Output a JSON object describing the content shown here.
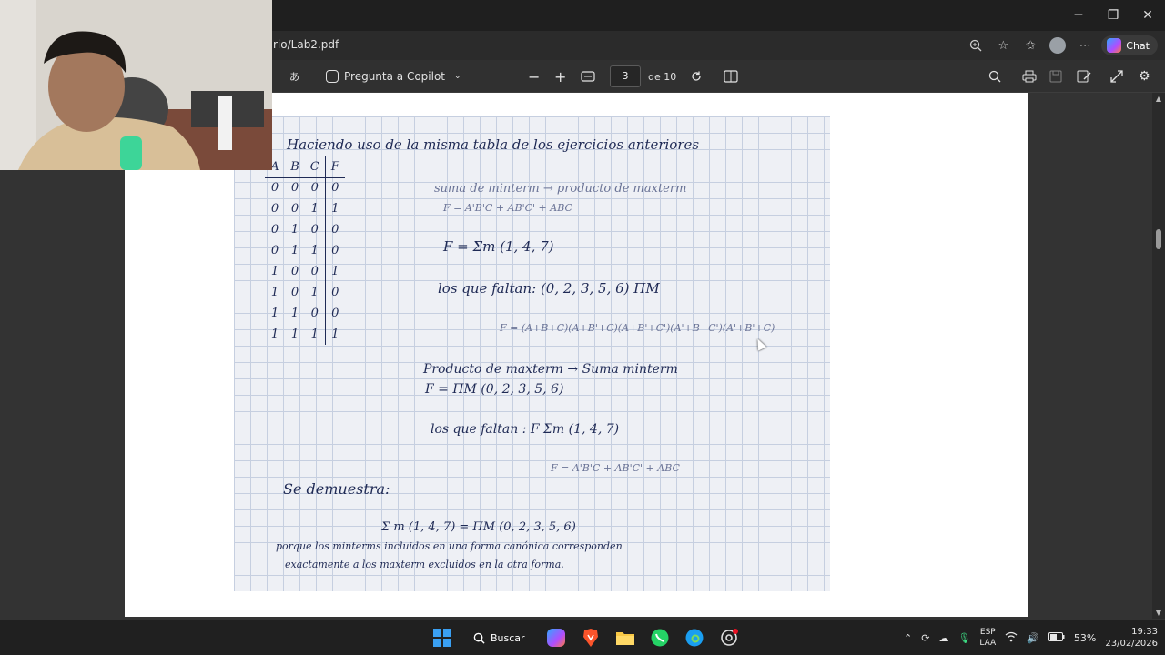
{
  "window": {
    "minimize": "─",
    "restore": "❐",
    "close": "✕"
  },
  "address": {
    "url": "rio/Lab2.pdf",
    "chat_label": "Chat",
    "more": "⋯"
  },
  "pdf_toolbar": {
    "copilot_label": "Pregunta a Copilot",
    "zoom_out": "−",
    "zoom_in": "+",
    "page_current": "3",
    "page_total": "de 10"
  },
  "notes": {
    "heading": "Haciendo uso de la misma tabla de los ejercicios anteriores",
    "table_header": [
      "A",
      "B",
      "C",
      "F"
    ],
    "table_rows": [
      [
        "0",
        "0",
        "0",
        "0"
      ],
      [
        "0",
        "0",
        "1",
        "1"
      ],
      [
        "0",
        "1",
        "0",
        "0"
      ],
      [
        "0",
        "1",
        "1",
        "0"
      ],
      [
        "1",
        "0",
        "0",
        "1"
      ],
      [
        "1",
        "0",
        "1",
        "0"
      ],
      [
        "1",
        "1",
        "0",
        "0"
      ],
      [
        "1",
        "1",
        "1",
        "1"
      ]
    ],
    "line1": "suma de minterm → producto de maxterm",
    "line2": "F = A'B'C + AB'C' + ABC",
    "line3": "F = Σm (1, 4, 7)",
    "line4": "los que faltan: (0, 2, 3, 5, 6) ΠM",
    "line5": "F = (A+B+C)(A+B'+C)(A+B'+C')(A'+B+C')(A'+B'+C)",
    "line6": "Producto de maxterm → Suma minterm",
    "line7": "F = ΠM (0, 2, 3, 5, 6)",
    "line8": "los que faltan : F Σm (1, 4, 7)",
    "line9": "F = A'B'C + AB'C' + ABC",
    "line10": "Se demuestra:",
    "line11": "Σ m (1, 4, 7) = ΠM (0, 2, 3, 5, 6)",
    "line12": "porque los minterms incluidos en una forma canónica corresponden",
    "line13": "exactamente a los maxterm excluidos en la otra forma."
  },
  "taskbar": {
    "search_label": "Buscar",
    "lang_top": "ESP",
    "lang_bottom": "LAA",
    "battery": "53%",
    "time": "19:33",
    "date": "23/02/2026"
  },
  "colors": {
    "ink": "#1f2a55",
    "grid": "#c6cfe0",
    "windows_blue": "#0078d4"
  }
}
